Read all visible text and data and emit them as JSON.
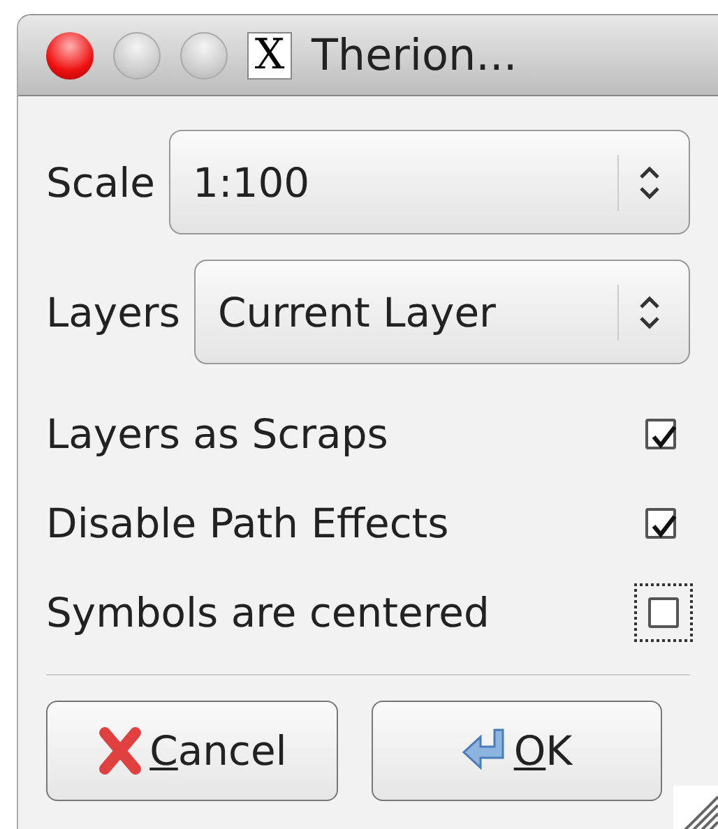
{
  "window": {
    "title": "Therion...",
    "icon": "X"
  },
  "fields": [
    {
      "label": "Scale",
      "value": "1:100"
    },
    {
      "label": "Layers",
      "value": "Current Layer"
    }
  ],
  "options": [
    {
      "label": "Layers as Scraps",
      "checked": true,
      "focused": false
    },
    {
      "label": "Disable Path Effects",
      "checked": true,
      "focused": false
    },
    {
      "label": "Symbols are centered",
      "checked": false,
      "focused": true
    }
  ],
  "buttons": [
    {
      "kind": "cancel",
      "label": "Cancel"
    },
    {
      "kind": "ok",
      "label": "OK"
    }
  ]
}
